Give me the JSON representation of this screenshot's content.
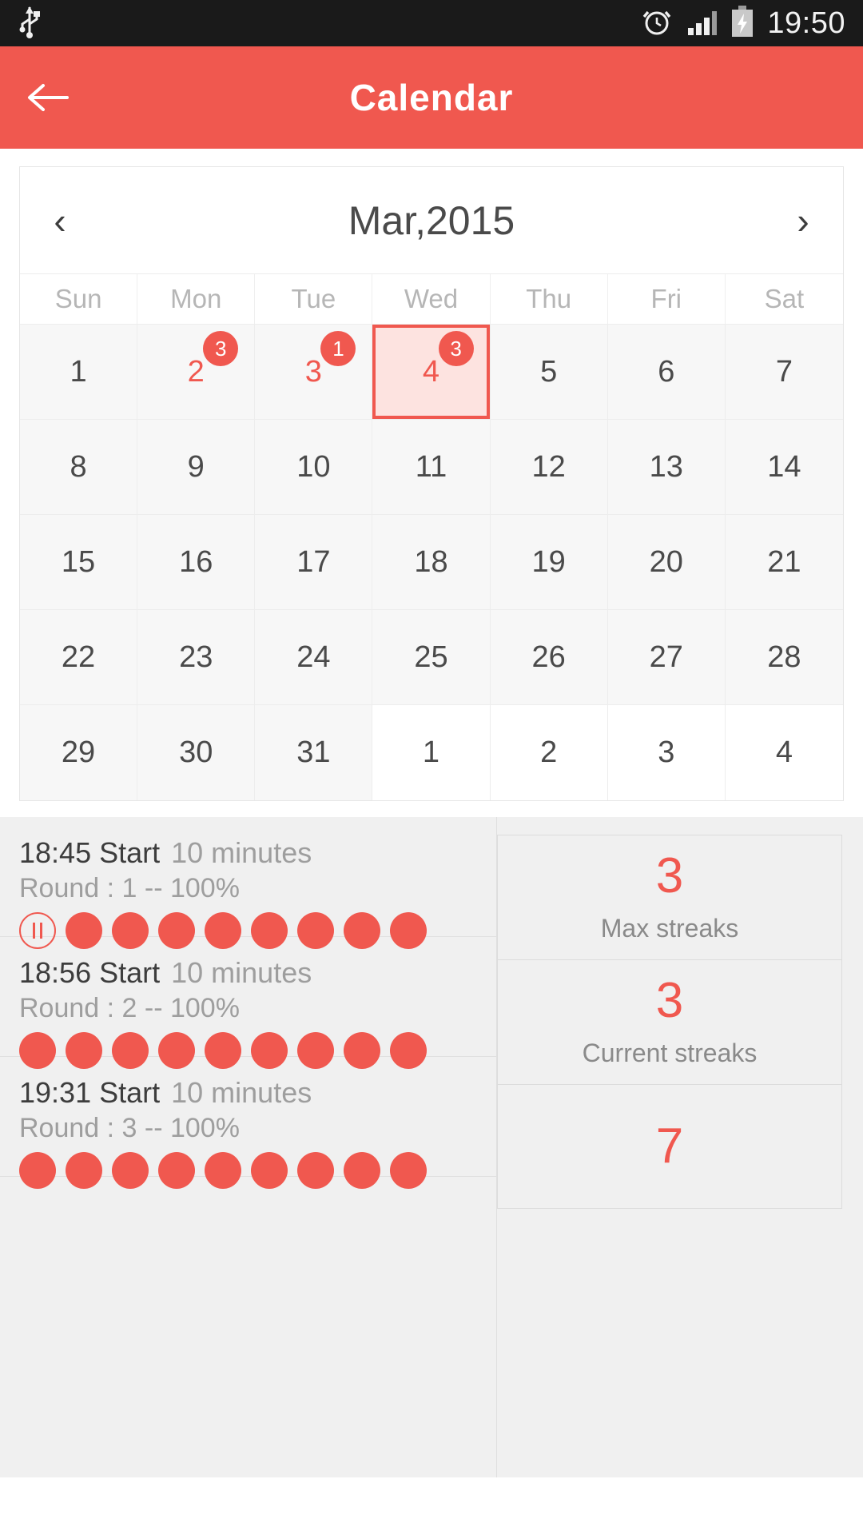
{
  "status_bar": {
    "time": "19:50",
    "icons": [
      "usb-icon",
      "alarm-icon",
      "signal-icon",
      "battery-charging-icon"
    ]
  },
  "app_bar": {
    "title": "Calendar",
    "back_label": "←"
  },
  "calendar": {
    "month_label": "Mar,2015",
    "prev_label": "‹",
    "next_label": "›",
    "weekdays": [
      "Sun",
      "Mon",
      "Tue",
      "Wed",
      "Thu",
      "Fri",
      "Sat"
    ],
    "accent_color": "#f0584f",
    "selected_day": 4,
    "weeks": [
      [
        {
          "n": "1",
          "cur": true
        },
        {
          "n": "2",
          "cur": true,
          "badge": "3",
          "event": true
        },
        {
          "n": "3",
          "cur": true,
          "badge": "1",
          "event": true
        },
        {
          "n": "4",
          "cur": true,
          "badge": "3",
          "event": true,
          "selected": true
        },
        {
          "n": "5",
          "cur": true
        },
        {
          "n": "6",
          "cur": true
        },
        {
          "n": "7",
          "cur": true
        }
      ],
      [
        {
          "n": "8",
          "cur": true
        },
        {
          "n": "9",
          "cur": true
        },
        {
          "n": "10",
          "cur": true
        },
        {
          "n": "11",
          "cur": true
        },
        {
          "n": "12",
          "cur": true
        },
        {
          "n": "13",
          "cur": true
        },
        {
          "n": "14",
          "cur": true
        }
      ],
      [
        {
          "n": "15",
          "cur": true
        },
        {
          "n": "16",
          "cur": true
        },
        {
          "n": "17",
          "cur": true
        },
        {
          "n": "18",
          "cur": true
        },
        {
          "n": "19",
          "cur": true
        },
        {
          "n": "20",
          "cur": true
        },
        {
          "n": "21",
          "cur": true
        }
      ],
      [
        {
          "n": "22",
          "cur": true
        },
        {
          "n": "23",
          "cur": true
        },
        {
          "n": "24",
          "cur": true
        },
        {
          "n": "25",
          "cur": true
        },
        {
          "n": "26",
          "cur": true
        },
        {
          "n": "27",
          "cur": true
        },
        {
          "n": "28",
          "cur": true
        }
      ],
      [
        {
          "n": "29",
          "cur": true
        },
        {
          "n": "30",
          "cur": true
        },
        {
          "n": "31",
          "cur": true
        },
        {
          "n": "1",
          "cur": false
        },
        {
          "n": "2",
          "cur": false
        },
        {
          "n": "3",
          "cur": false
        },
        {
          "n": "4",
          "cur": false
        }
      ]
    ]
  },
  "sessions": [
    {
      "time": "18:45 Start",
      "duration": "10 minutes",
      "round": "Round : 1 -- 100%",
      "leading_pause": true,
      "dots": 8
    },
    {
      "time": "18:56 Start",
      "duration": "10 minutes",
      "round": "Round : 2 -- 100%",
      "leading_pause": false,
      "dots": 9
    },
    {
      "time": "19:31 Start",
      "duration": "10 minutes",
      "round": "Round : 3 -- 100%",
      "leading_pause": false,
      "dots": 9
    }
  ],
  "streaks": [
    {
      "value": "3",
      "label": "Max streaks"
    },
    {
      "value": "3",
      "label": "Current streaks"
    },
    {
      "value": "7",
      "label": ""
    }
  ]
}
